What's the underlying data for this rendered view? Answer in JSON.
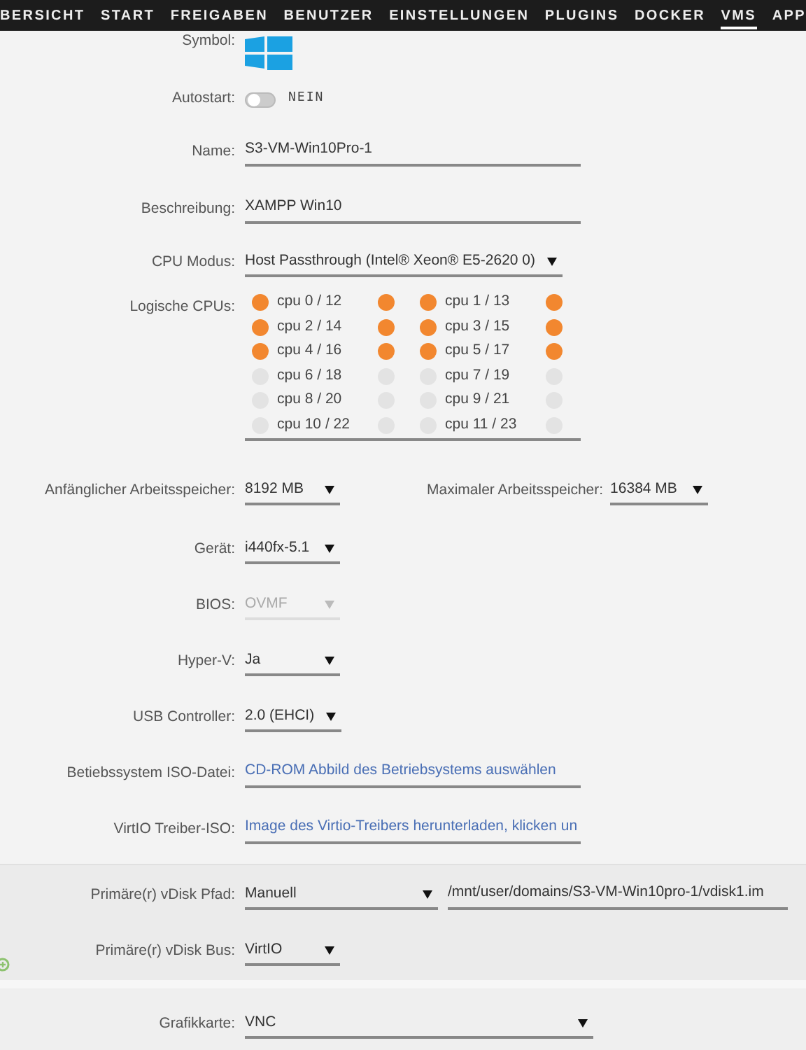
{
  "nav": [
    {
      "label": "BERSICHT",
      "selected": false
    },
    {
      "label": "START",
      "selected": false
    },
    {
      "label": "FREIGABEN",
      "selected": false
    },
    {
      "label": "BENUTZER",
      "selected": false
    },
    {
      "label": "EINSTELLUNGEN",
      "selected": false
    },
    {
      "label": "PLUGINS",
      "selected": false
    },
    {
      "label": "DOCKER",
      "selected": false
    },
    {
      "label": "VMS",
      "selected": true
    },
    {
      "label": "APP",
      "selected": false
    }
  ],
  "sections": [
    {
      "rows": [
        {
          "kind": "icon",
          "label": "Symbol:"
        },
        {
          "kind": "toggle",
          "label": "Autostart:",
          "on": false,
          "state_text": "NEIN"
        },
        {
          "kind": "text",
          "label": "Name:",
          "value": "S3-VM-Win10Pro-1"
        },
        {
          "kind": "text",
          "label": "Beschreibung:",
          "value": "XAMPP Win10"
        },
        {
          "kind": "select",
          "label": "CPU Modus:",
          "value": "Host Passthrough (Intel® Xeon® E5-2620 0)",
          "disabled": false
        },
        {
          "kind": "cpus",
          "label": "Logische CPUs:",
          "cpus": [
            {
              "label": "cpu 0 / 12",
              "checked": true,
              "sibling_checked": true
            },
            {
              "label": "cpu 1 / 13",
              "checked": true,
              "sibling_checked": true
            },
            {
              "label": "cpu 2 / 14",
              "checked": true,
              "sibling_checked": true
            },
            {
              "label": "cpu 3 / 15",
              "checked": true,
              "sibling_checked": true
            },
            {
              "label": "cpu 4 / 16",
              "checked": true,
              "sibling_checked": true
            },
            {
              "label": "cpu 5 / 17",
              "checked": true,
              "sibling_checked": true
            },
            {
              "label": "cpu 6 / 18",
              "checked": false,
              "sibling_checked": false
            },
            {
              "label": "cpu 7 / 19",
              "checked": false,
              "sibling_checked": false
            },
            {
              "label": "cpu 8 / 20",
              "checked": false,
              "sibling_checked": false
            },
            {
              "label": "cpu 9 / 21",
              "checked": false,
              "sibling_checked": false
            },
            {
              "label": "cpu 10 / 22",
              "checked": false,
              "sibling_checked": false
            },
            {
              "label": "cpu 11 / 23",
              "checked": false,
              "sibling_checked": false
            }
          ]
        },
        {
          "kind": "memory",
          "label": "Anfänglicher Arbeitsspeicher:",
          "value": "8192 MB",
          "max_label": "Maximaler Arbeitsspeicher:",
          "max_value": "16384 MB"
        },
        {
          "kind": "select",
          "label": "Gerät:",
          "value": "i440fx-5.1",
          "disabled": false
        },
        {
          "kind": "select",
          "label": "BIOS:",
          "value": "OVMF",
          "disabled": true
        },
        {
          "kind": "select",
          "label": "Hyper-V:",
          "value": "Ja",
          "disabled": false
        },
        {
          "kind": "select",
          "label": "USB Controller:",
          "value": "2.0 (EHCI)",
          "disabled": false
        },
        {
          "kind": "link",
          "label": "Betiebssystem ISO-Datei:",
          "value": "CD-ROM Abbild des Betriebsystems auswählen"
        },
        {
          "kind": "link",
          "label": "VirtIO Treiber-ISO:",
          "value": "Image des Virtio-Treibers herunterladen, klicken un"
        }
      ]
    },
    {
      "add_button": true,
      "rows": [
        {
          "kind": "path",
          "label": "Primäre(r) vDisk Pfad:",
          "value": "Manuell",
          "path": "/mnt/user/domains/S3-VM-Win10pro-1/vdisk1.im"
        },
        {
          "kind": "select",
          "label": "Primäre(r) vDisk Bus:",
          "value": "VirtIO",
          "disabled": false
        }
      ]
    },
    {
      "rows": [
        {
          "kind": "select_wide",
          "label": "Grafikkarte:",
          "value": "VNC",
          "disabled": false
        }
      ]
    }
  ]
}
